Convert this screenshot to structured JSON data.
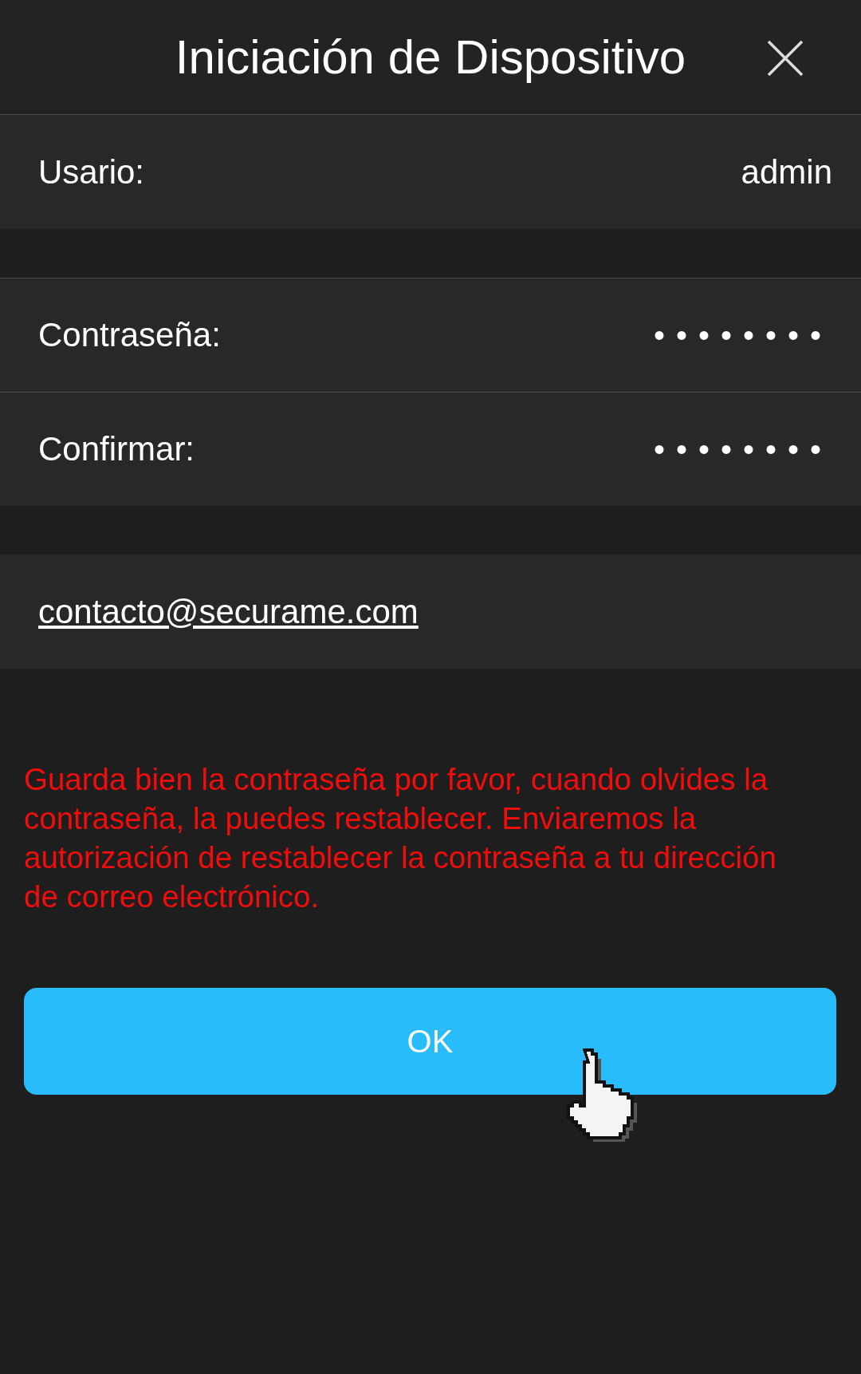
{
  "header": {
    "title": "Iniciación de Dispositivo"
  },
  "user": {
    "label": "Usario:",
    "value": "admin"
  },
  "password_fields": [
    {
      "label": "Contraseña:",
      "value": "••••••••"
    },
    {
      "label": "Confirmar:",
      "value": "••••••••"
    }
  ],
  "email": {
    "value": "contacto@securame.com"
  },
  "warning": "Guarda bien la contraseña por favor, cuando olvides la contraseña, la puedes restablecer. Enviaremos la autorización de restablecer la contraseña a tu dirección de correo electrónico.",
  "ok_button": {
    "label": "OK"
  }
}
